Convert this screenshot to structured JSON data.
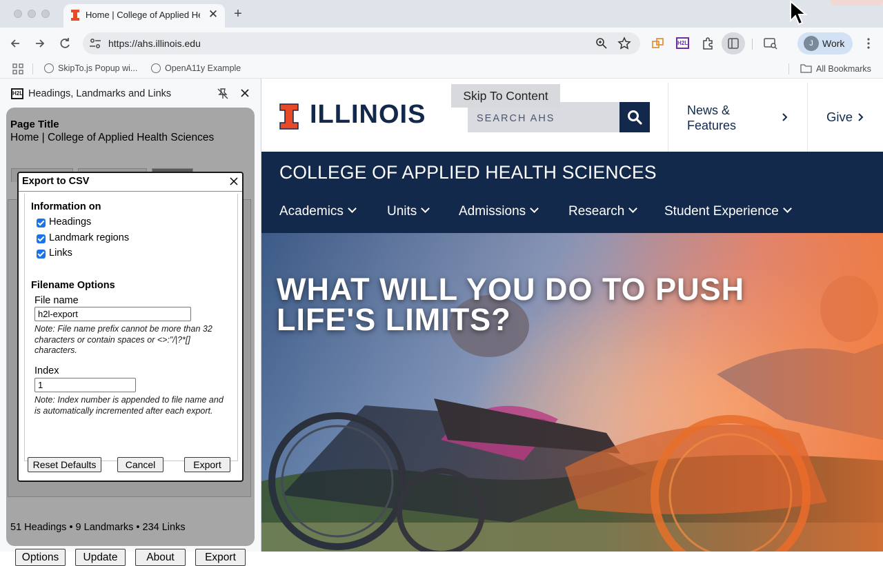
{
  "browser": {
    "tab": {
      "title": "Home | College of Applied Health Sciences",
      "close": "✕"
    },
    "new_tab": "+",
    "url": "https://ahs.illinois.edu",
    "profile": {
      "initial": "J",
      "label": "Work"
    },
    "bookmarks": [
      {
        "label": "SkipTo.js Popup wi..."
      },
      {
        "label": "OpenA11y Example"
      }
    ],
    "all_bookmarks": "All Bookmarks",
    "extension_badge": "H2L"
  },
  "side_panel": {
    "logo": "H2L",
    "title": "Headings, Landmarks and Links",
    "page_title_label": "Page Title",
    "page_title_value": "Home | College of Applied Health Sciences",
    "summary": "51 Headings • 9 Landmarks • 234 Links",
    "buttons": {
      "options": "Options",
      "update": "Update",
      "about": "About",
      "export": "Export"
    }
  },
  "dialog": {
    "title": "Export to CSV",
    "close": "✕",
    "info_heading": "Information on",
    "checkboxes": [
      {
        "label": "Headings",
        "checked": true
      },
      {
        "label": "Landmark regions",
        "checked": true
      },
      {
        "label": "Links",
        "checked": true
      }
    ],
    "filename_heading": "Filename Options",
    "file_name_label": "File name",
    "file_name_value": "h2l-export",
    "file_name_note": "Note: File name prefix cannot be more than 32 characters or contain spaces or <>:\"/|?*[] characters.",
    "index_label": "Index",
    "index_value": "1",
    "index_note": "Note: Index number is appended to file name and is automatically incremented after each export.",
    "buttons": {
      "reset": "Reset Defaults",
      "cancel": "Cancel",
      "export": "Export"
    }
  },
  "web": {
    "wordmark": "ILLINOIS",
    "skip_link": "Skip To Content",
    "search_placeholder": "SEARCH AHS",
    "news_line1": "News &",
    "news_line2": "Features",
    "give": "Give",
    "college": "COLLEGE OF APPLIED HEALTH SCIENCES",
    "nav": [
      "Academics",
      "Units",
      "Admissions",
      "Research",
      "Student Experience"
    ],
    "hero_line1": "WHAT WILL YOU DO TO PUSH",
    "hero_line2": "LIFE'S LIMITS?",
    "colors": {
      "illinois_blue": "#13294B",
      "illinois_orange": "#E84A27"
    }
  }
}
